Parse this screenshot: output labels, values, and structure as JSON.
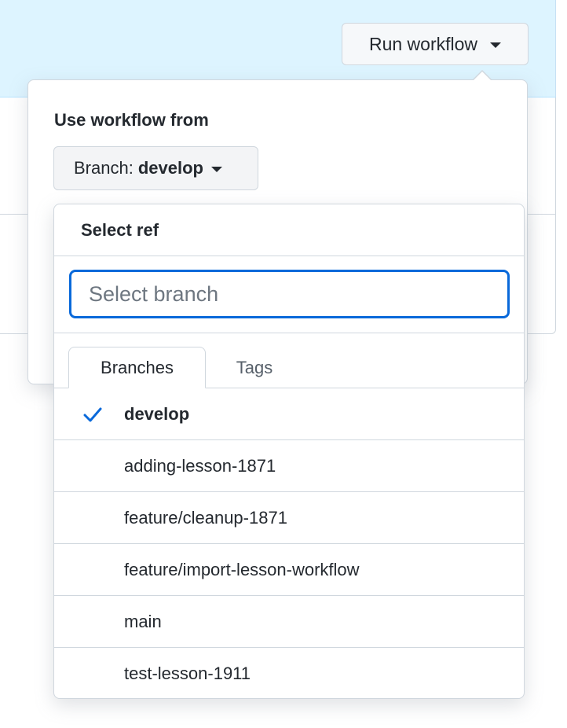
{
  "toolbar": {
    "run_workflow_label": "Run workflow"
  },
  "popover": {
    "title": "Use workflow from",
    "branch_button": {
      "prefix": "Branch:",
      "value": "develop"
    }
  },
  "ref_menu": {
    "title": "Select ref",
    "filter": {
      "placeholder": "Select branch",
      "value": ""
    },
    "tabs": [
      {
        "label": "Branches",
        "selected": true
      },
      {
        "label": "Tags",
        "selected": false
      }
    ],
    "branches": [
      {
        "name": "develop",
        "selected": true
      },
      {
        "name": "adding-lesson-1871",
        "selected": false
      },
      {
        "name": "feature/cleanup-1871",
        "selected": false
      },
      {
        "name": "feature/import-lesson-workflow",
        "selected": false
      },
      {
        "name": "main",
        "selected": false
      },
      {
        "name": "test-lesson-1911",
        "selected": false
      }
    ]
  },
  "colors": {
    "accent": "#0969da",
    "banner": "#ddf4ff",
    "border": "#d0d7de",
    "button_bg": "#f6f8fa"
  },
  "icons": {
    "dropdown": "caret-down-icon",
    "selected_branch": "check-icon"
  }
}
